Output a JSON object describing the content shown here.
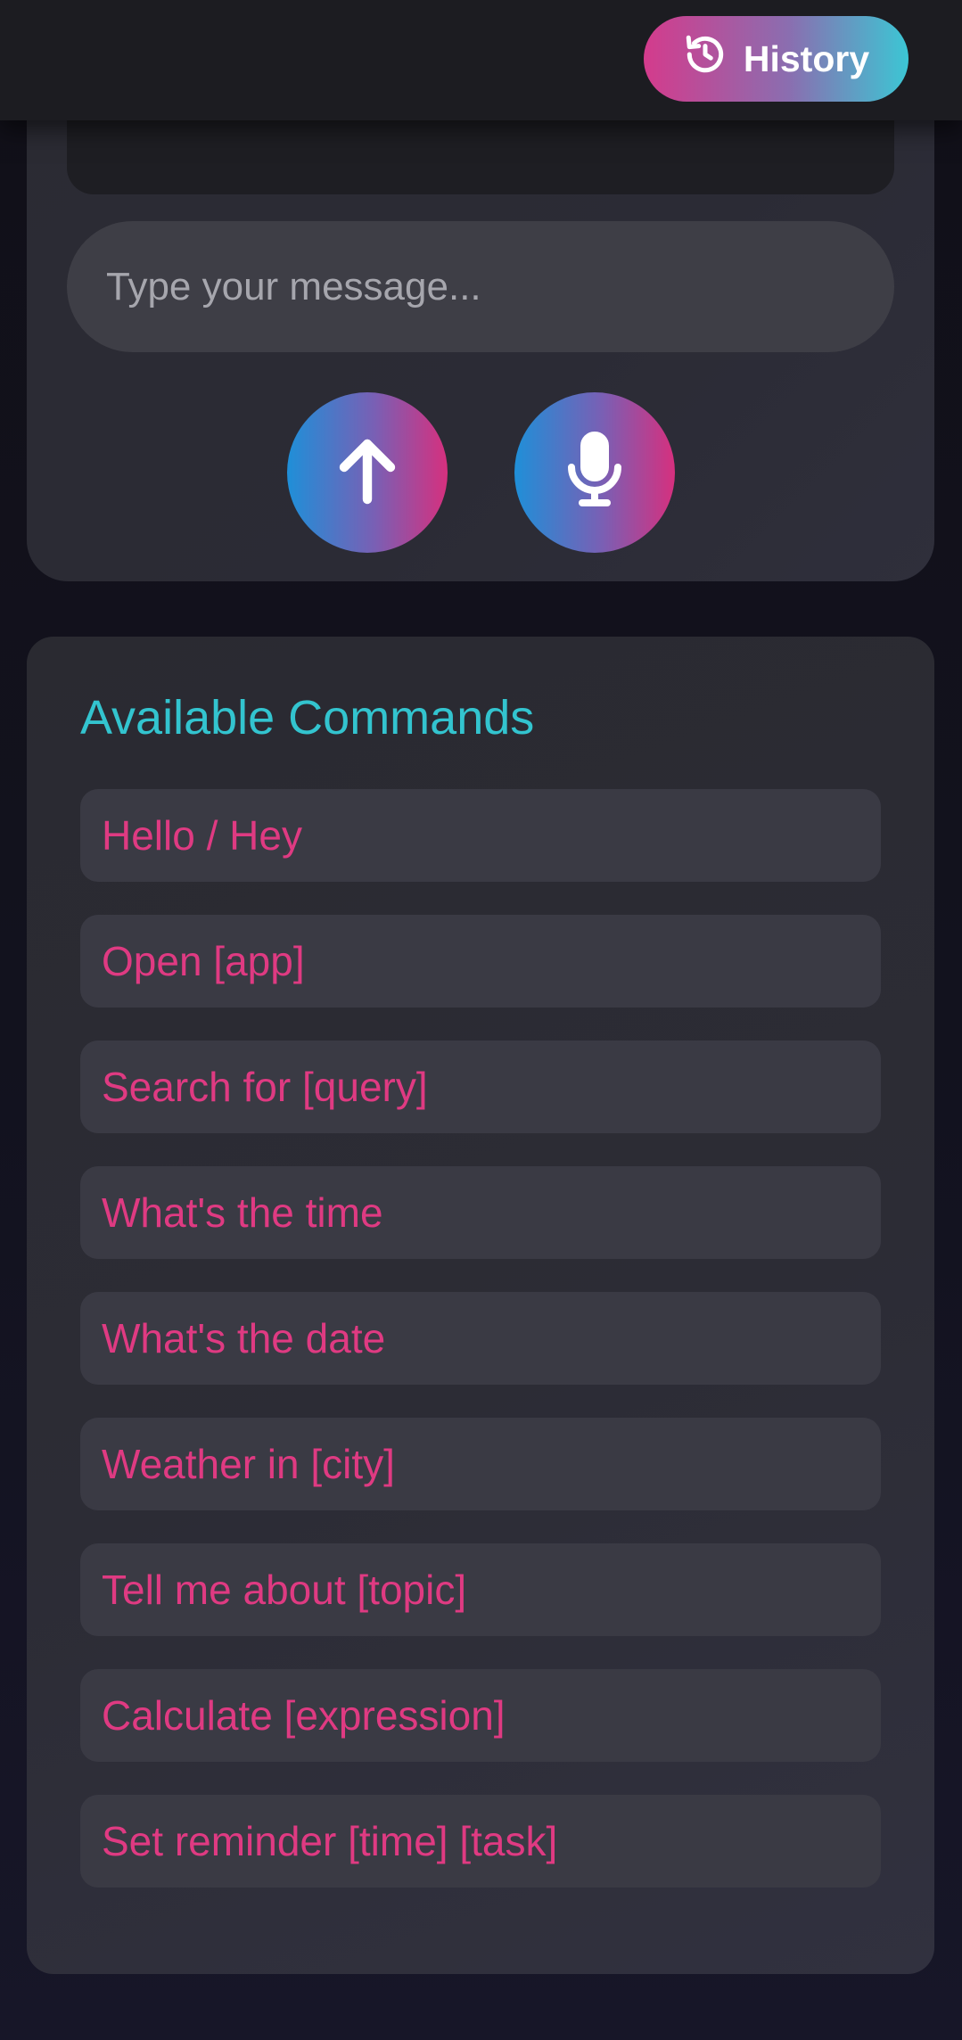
{
  "header": {
    "history_label": "History",
    "history_icon": "history-icon"
  },
  "chat": {
    "placeholder": "Type your message...",
    "send_icon": "arrow-up-icon",
    "mic_icon": "microphone-icon"
  },
  "commands": {
    "title": "Available Commands",
    "items": [
      {
        "label": "Hello / Hey"
      },
      {
        "label": "Open [app]"
      },
      {
        "label": "Search for [query]"
      },
      {
        "label": "What's the time"
      },
      {
        "label": "What's the date"
      },
      {
        "label": "Weather in [city]"
      },
      {
        "label": "Tell me about [topic]"
      },
      {
        "label": "Calculate [expression]"
      },
      {
        "label": "Set reminder [time] [task]"
      }
    ]
  },
  "colors": {
    "accent_cyan": "#33c4cf",
    "accent_pink": "#df3a82",
    "gradient_blue": "#1f8fd8"
  }
}
